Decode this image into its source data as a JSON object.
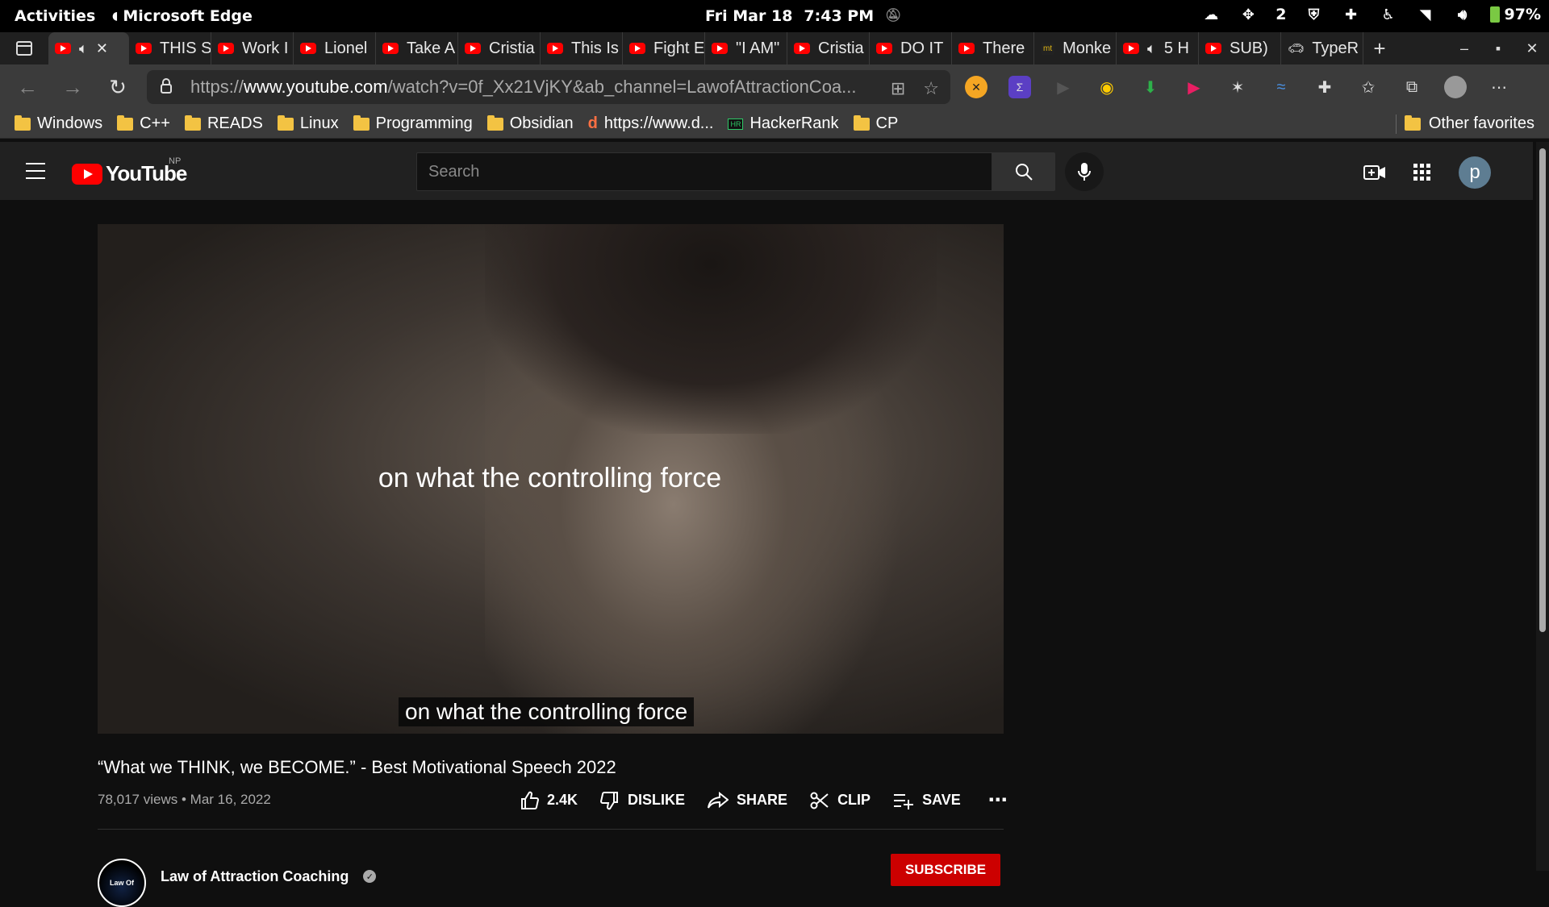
{
  "system_bar": {
    "activities": "Activities",
    "app_name": "Microsoft Edge",
    "date": "Fri Mar 18",
    "time": "7:43 PM",
    "workspace_count": "2",
    "battery": "97%"
  },
  "tabs": [
    {
      "label": "",
      "active": true
    },
    {
      "label": "THIS S"
    },
    {
      "label": "Work I"
    },
    {
      "label": "Lionel"
    },
    {
      "label": "Take A"
    },
    {
      "label": "Cristia"
    },
    {
      "label": "This Is"
    },
    {
      "label": "Fight E"
    },
    {
      "label": "\"I AM\""
    },
    {
      "label": "Cristia"
    },
    {
      "label": "DO IT"
    },
    {
      "label": "There"
    },
    {
      "label": "Monke"
    },
    {
      "label": "5 H"
    },
    {
      "label": "SUB)"
    },
    {
      "label": "TypeR"
    }
  ],
  "address_bar": {
    "url_prefix": "https://",
    "url_host": "www.youtube.com",
    "url_rest": "/watch?v=0f_Xx21VjKY&ab_channel=LawofAttractionCoa..."
  },
  "bookmarks": [
    {
      "label": "Windows",
      "icon": "folder"
    },
    {
      "label": "C++",
      "icon": "folder"
    },
    {
      "label": "READS",
      "icon": "folder"
    },
    {
      "label": "Linux",
      "icon": "folder"
    },
    {
      "label": "Programming",
      "icon": "folder"
    },
    {
      "label": "Obsidian",
      "icon": "folder"
    },
    {
      "label": "https://www.d...",
      "icon": "site"
    },
    {
      "label": "HackerRank",
      "icon": "hackerrank"
    },
    {
      "label": "CP",
      "icon": "folder"
    }
  ],
  "bookmarks_other": "Other favorites",
  "youtube": {
    "logo_text": "YouTube",
    "region": "NP",
    "search_placeholder": "Search",
    "avatar_letter": "p",
    "video_overlay_text": "on what the controlling force",
    "caption": "on what the controlling force",
    "title": "“What we THINK, we BECOME.” - Best Motivational Speech 2022",
    "views": "78,017 views",
    "date": "Mar 16, 2022",
    "likes": "2.4K",
    "dislike_label": "DISLIKE",
    "share_label": "SHARE",
    "clip_label": "CLIP",
    "save_label": "SAVE",
    "channel_name": "Law of Attraction Coaching",
    "channel_avatar_text": "Law Of",
    "subscribe_label": "SUBSCRIBE"
  },
  "colors": {
    "youtube_red": "#ff0000",
    "subscribe_red": "#cc0000",
    "page_bg": "#0f0f0f",
    "header_bg": "#212121"
  }
}
